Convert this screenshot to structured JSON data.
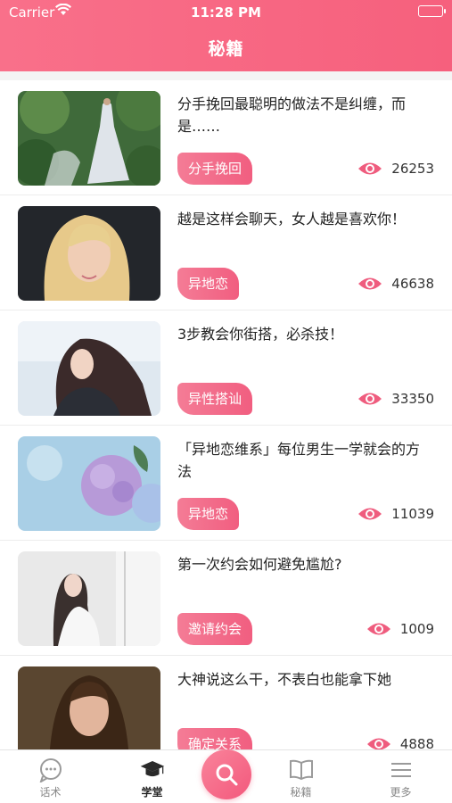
{
  "status_bar": {
    "carrier": "Carrier",
    "time": "11:28 PM"
  },
  "header": {
    "title": "秘籍"
  },
  "articles": [
    {
      "title": "分手挽回最聪明的做法不是纠缠，而是……",
      "tag": "分手挽回",
      "views": "26253",
      "image": "woman-in-white-dress-forest"
    },
    {
      "title": "越是这样会聊天，女人越是喜欢你！",
      "tag": "异地恋",
      "views": "46638",
      "image": "blonde-woman-portrait"
    },
    {
      "title": "3步教会你街搭，必杀技！",
      "tag": "异性搭讪",
      "views": "33350",
      "image": "woman-hair-in-wind"
    },
    {
      "title": "「异地恋维系」每位男生一学就会的方法",
      "tag": "异地恋",
      "views": "11039",
      "image": "purple-hydrangea-flowers"
    },
    {
      "title": "第一次约会如何避免尴尬?",
      "tag": "邀请约会",
      "views": "1009",
      "image": "woman-near-window"
    },
    {
      "title": "大神说这么干，不表白也能拿下她",
      "tag": "确定关系",
      "views": "4888",
      "image": "brunette-woman-portrait"
    }
  ],
  "tabbar": {
    "tabs": [
      {
        "label": "话术",
        "icon": "chat-bubble-icon"
      },
      {
        "label": "学堂",
        "icon": "graduation-cap-icon"
      },
      {
        "label": "",
        "icon": "search-icon"
      },
      {
        "label": "秘籍",
        "icon": "open-book-icon"
      },
      {
        "label": "更多",
        "icon": "menu-lines-icon"
      }
    ],
    "active": "学堂"
  },
  "colors": {
    "accent": "#f6607d",
    "tag_start": "#f47c96",
    "tag_end": "#f15e80"
  }
}
